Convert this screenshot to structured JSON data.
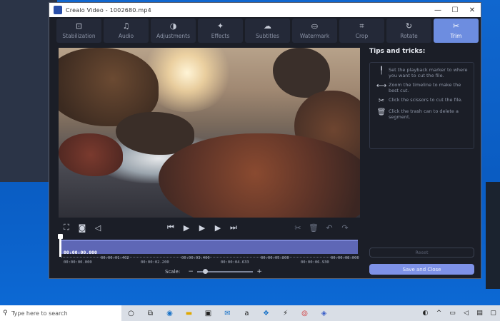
{
  "window": {
    "title": "Crealo Video - 1002680.mp4",
    "minimize": "—",
    "maximize": "☐",
    "close": "✕"
  },
  "tabs": [
    {
      "label": "Stabilization",
      "icon": "stabilization-icon",
      "glyph": "⊡",
      "active": false
    },
    {
      "label": "Audio",
      "icon": "music-note-icon",
      "glyph": "♫",
      "active": false
    },
    {
      "label": "Adjustments",
      "icon": "contrast-icon",
      "glyph": "◑",
      "active": false
    },
    {
      "label": "Effects",
      "icon": "magic-wand-icon",
      "glyph": "✦",
      "active": false
    },
    {
      "label": "Subtitles",
      "icon": "speech-bubble-icon",
      "glyph": "☁",
      "active": false
    },
    {
      "label": "Watermark",
      "icon": "stamp-icon",
      "glyph": "⛀",
      "active": false
    },
    {
      "label": "Crop",
      "icon": "crop-icon",
      "glyph": "⌗",
      "active": false
    },
    {
      "label": "Rotate",
      "icon": "rotate-icon",
      "glyph": "↻",
      "active": false
    },
    {
      "label": "Trim",
      "icon": "scissors-icon",
      "glyph": "✂",
      "active": true
    }
  ],
  "controls": {
    "fullscreen": "⛶",
    "snapshot": "◙",
    "volume": "◁",
    "to_start": "⏮",
    "prev_frame": "◀",
    "play": "▶",
    "next_frame": "▶",
    "to_end": "⏭",
    "cut": "✂",
    "trash": "🗑",
    "undo": "↶",
    "redo": "↷"
  },
  "timeline": {
    "current_time": "00:00:00.000",
    "tick_labels": [
      "00:00:00.000",
      "00:00:01.402",
      "00:00:02.200",
      "00:00:03.400",
      "00:00:04.633",
      "00:00:05.800",
      "00:00:06.930",
      "00:00:08.000"
    ],
    "position": 0
  },
  "scale": {
    "label": "Scale:",
    "minus": "−",
    "plus": "+",
    "value": 0.1
  },
  "tips": {
    "title": "Tips and tricks:",
    "items": [
      {
        "text": "Set the playback marker to where you want to cut the file.",
        "icon": "marker-icon",
        "glyph": "╿"
      },
      {
        "text": "Zoom the timeline to make the best cut.",
        "icon": "zoom-timeline-icon",
        "glyph": "⟷"
      },
      {
        "text": "Click the scissors to cut the file.",
        "icon": "scissors-icon",
        "glyph": "✂"
      },
      {
        "text": "Click the trash can to delete a segment.",
        "icon": "trash-icon",
        "glyph": "🗑"
      }
    ]
  },
  "buttons": {
    "reset": "Reset",
    "save": "Save and Close"
  },
  "taskbar": {
    "search_placeholder": "Type here to search",
    "search_glyph": "⚲"
  }
}
